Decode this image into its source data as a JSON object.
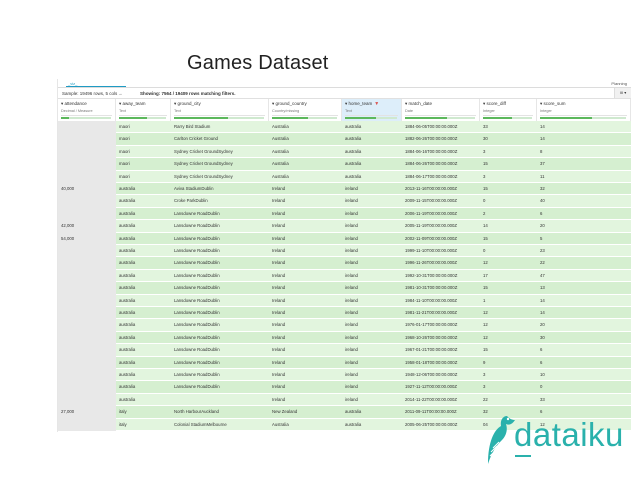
{
  "slide": {
    "title": "Games Dataset"
  },
  "app": {
    "breadcrumb": "_viz_",
    "right_link": "Planning",
    "status": {
      "sample": "Sample: 19496 rows, 5 cols",
      "arrow": "→",
      "showing": "Showing: 7564 / 19409 rows matching filters.",
      "button": "III ▾"
    },
    "columns": [
      {
        "name": "attendance",
        "type": "Decimal / Measure",
        "fill": 0.15
      },
      {
        "name": "away_team",
        "type": "Text",
        "fill": 0.6
      },
      {
        "name": "ground_city",
        "type": "Text",
        "fill": 0.6
      },
      {
        "name": "ground_country",
        "type": "Country/missing",
        "fill": 0.55
      },
      {
        "name": "home_team",
        "type": "Text",
        "fill": 0.6,
        "selected": true,
        "filter_icon": "filter-icon"
      },
      {
        "name": "match_date",
        "type": "Date",
        "fill": 0.6
      },
      {
        "name": "score_diff",
        "type": "Integer",
        "fill": 0.6
      },
      {
        "name": "score_sum",
        "type": "Integer",
        "fill": 0.6
      }
    ],
    "rows": [
      [
        "",
        "maori",
        "Rarry Bird Stadium",
        "Australia",
        "australia",
        "1884-06-05T00:00:00.000Z",
        "33",
        "14"
      ],
      [
        "",
        "maori",
        "Carlton Cricket Ground",
        "Australia",
        "australia",
        "1882-06-26T00:00:00.000Z",
        "30",
        "14"
      ],
      [
        "",
        "maori",
        "Sydney Cricket GroundSydney",
        "Australia",
        "australia",
        "1884-06-16T00:00:00.000Z",
        "3",
        "8"
      ],
      [
        "",
        "maori",
        "Sydney Cricket GroundSydney",
        "Australia",
        "australia",
        "1884-06-26T00:00:00.000Z",
        "15",
        "37"
      ],
      [
        "",
        "maori",
        "Sydney Cricket GroundSydney",
        "Australia",
        "australia",
        "1884-06-17T00:00:00.000Z",
        "3",
        "11"
      ],
      [
        "40,000",
        "australia",
        "Aviva StadiumDublin",
        "Ireland",
        "ireland",
        "2013-11-16T00:00:00.000Z",
        "15",
        "32"
      ],
      [
        "",
        "australia",
        "Croke ParkDublin",
        "Ireland",
        "ireland",
        "2009-11-15T00:00:00.000Z",
        "0",
        "40"
      ],
      [
        "",
        "australia",
        "Lansdowne RoadDublin",
        "Ireland",
        "ireland",
        "2006-11-19T00:00:00.000Z",
        "2",
        "6"
      ],
      [
        "42,000",
        "australia",
        "Lansdowne RoadDublin",
        "Ireland",
        "ireland",
        "2005-11-19T00:00:00.000Z",
        "14",
        "20"
      ],
      [
        "54,000",
        "australia",
        "Lansdowne RoadDublin",
        "Ireland",
        "ireland",
        "2002-11-09T00:00:00.000Z",
        "15",
        "5"
      ],
      [
        "",
        "australia",
        "Lansdowne RoadDublin",
        "Ireland",
        "ireland",
        "1999-11-10T00:00:00.000Z",
        "0",
        "23"
      ],
      [
        "",
        "australia",
        "Lansdowne RoadDublin",
        "Ireland",
        "ireland",
        "1996-11-26T00:00:00.000Z",
        "12",
        "22"
      ],
      [
        "",
        "australia",
        "Lansdowne RoadDublin",
        "Ireland",
        "ireland",
        "1992-10-31T00:00:00.000Z",
        "17",
        "47"
      ],
      [
        "",
        "australia",
        "Lansdowne RoadDublin",
        "Ireland",
        "ireland",
        "1981-10-31T00:00:00.000Z",
        "15",
        "13"
      ],
      [
        "",
        "australia",
        "Lansdowne RoadDublin",
        "Ireland",
        "ireland",
        "1984-11-10T00:00:00.000Z",
        "1",
        "14"
      ],
      [
        "",
        "australia",
        "Lansdowne RoadDublin",
        "Ireland",
        "ireland",
        "1981-11-21T00:00:00.000Z",
        "12",
        "14"
      ],
      [
        "",
        "australia",
        "Lansdowne RoadDublin",
        "Ireland",
        "ireland",
        "1976-01-17T00:00:00.000Z",
        "12",
        "20"
      ],
      [
        "",
        "australia",
        "Lansdowne RoadDublin",
        "Ireland",
        "ireland",
        "1968-10-26T00:00:00.000Z",
        "12",
        "30"
      ],
      [
        "",
        "australia",
        "Lansdowne RoadDublin",
        "Ireland",
        "ireland",
        "1967-01-21T00:00:00.000Z",
        "15",
        "6"
      ],
      [
        "",
        "australia",
        "Lansdowne RoadDublin",
        "Ireland",
        "ireland",
        "1958-01-18T00:00:00.000Z",
        "9",
        "6"
      ],
      [
        "",
        "australia",
        "Lansdowne RoadDublin",
        "Ireland",
        "ireland",
        "1948-12-06T00:00:00.000Z",
        "3",
        "10"
      ],
      [
        "",
        "australia",
        "Lansdowne RoadDublin",
        "Ireland",
        "ireland",
        "1927-11-12T00:00:00.000Z",
        "3",
        "0"
      ],
      [
        "",
        "australia",
        "",
        "Ireland",
        "ireland",
        "2014-11-22T00:00:00.000Z",
        "22",
        "33"
      ],
      [
        "27,000",
        "italy",
        "North HarbourAuckland",
        "New Zealand",
        "australia",
        "2011-09-11T00:00:00.000Z",
        "32",
        "6"
      ],
      [
        "",
        "italy",
        "Colonial StadiumMelbourne",
        "Australia",
        "australia",
        "2005-06-25T00:00:00.000Z",
        "04",
        "12"
      ]
    ]
  },
  "logo": {
    "text": "dataiku",
    "icon": "bird-icon",
    "color": "#2ab1ac"
  }
}
